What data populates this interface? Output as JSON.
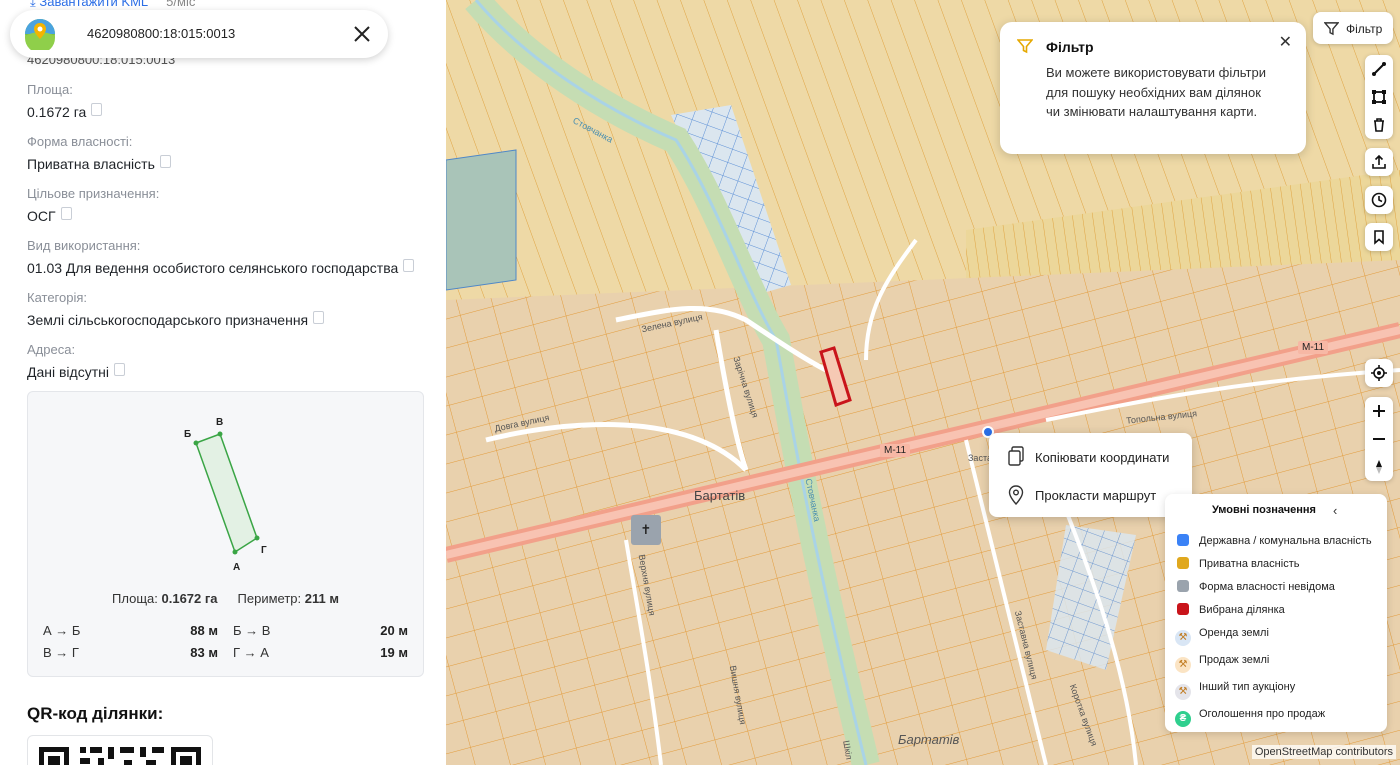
{
  "top_link": {
    "text": "Завантажити KML",
    "extra": "5/міс"
  },
  "search": {
    "cadastral": "4620980800:18:015:0013"
  },
  "parcel": {
    "id_partial": "4620980800:18:015:0013",
    "fields": [
      {
        "label": "Площа:",
        "value": "0.1672 га"
      },
      {
        "label": "Форма власності:",
        "value": "Приватна власність"
      },
      {
        "label": "Цільове призначення:",
        "value": "ОСГ"
      },
      {
        "label": "Вид використання:",
        "value": "01.03 Для ведення особистого селянського господарства"
      },
      {
        "label": "Категорія:",
        "value": "Землі сільськогосподарського призначення"
      },
      {
        "label": "Адреса:",
        "value": "Дані відсутні"
      }
    ]
  },
  "shape_card": {
    "vertices": [
      "А",
      "Б",
      "В",
      "Г"
    ],
    "area_label": "Площа:",
    "area_value": "0.1672 га",
    "perimeter_label": "Периметр:",
    "perimeter_value": "211 м",
    "segments": [
      {
        "label": "А → Б",
        "value": "88 м"
      },
      {
        "label": "Б → В",
        "value": "20 м"
      },
      {
        "label": "В → Г",
        "value": "83 м"
      },
      {
        "label": "Г → А",
        "value": "19 м"
      }
    ],
    "stroke_color": "#3aa545"
  },
  "qr": {
    "title": "QR-код ділянки:"
  },
  "filter_button": {
    "label": "Фільтр"
  },
  "filter_tip": {
    "title": "Фільтр",
    "body": "Ви можете використовувати фільтри для пошуку необхідних вам ділянок чи змінювати налаштування карти."
  },
  "context_menu": [
    {
      "label": "Копіювати координати",
      "icon": "copy-icon"
    },
    {
      "label": "Прокласти маршрут",
      "icon": "location-pin-icon"
    }
  ],
  "legend": {
    "title": "Умовні позначення",
    "items": [
      {
        "label": "Державна / комунальна власність",
        "color": "#3b82f6",
        "kind": "square"
      },
      {
        "label": "Приватна власність",
        "color": "#e0a81e",
        "kind": "square"
      },
      {
        "label": "Форма власності невідома",
        "color": "#9aa3ad",
        "kind": "square"
      },
      {
        "label": "Вибрана ділянка",
        "color": "#c9141b",
        "kind": "square"
      },
      {
        "label": "Оренда землі",
        "color": "#d9e6f5",
        "kind": "circle"
      },
      {
        "label": "Продаж землі",
        "color": "#fbe4c4",
        "kind": "circle"
      },
      {
        "label": "Інший тип аукціону",
        "color": "#e4e4ea",
        "kind": "circle"
      },
      {
        "label": "Оголошення про продаж",
        "color": "#2fcf8e",
        "kind": "circle",
        "glyph": "₴"
      }
    ]
  },
  "map_labels": {
    "village_1": "Бартатів",
    "village_2": "Бартатів",
    "road_1": "М-11",
    "road_2": "М-11",
    "stream_1": "Стовчанка",
    "stream_2": "Стовчанка",
    "street_green": "Зелена вулиця",
    "street_long": "Довга вулиця",
    "street_zarichna": "Зарічна вулиця",
    "street_topolna": "Топольна вулиця",
    "street_verkhnia": "Верхня вулиця",
    "street_zastavna": "Заставна вулиця",
    "street_korotka": "Коротка вулиця",
    "street_vyshnia": "Вишня вулиця",
    "street_partial_1": "Заста",
    "street_partial_2": "Шкіл"
  },
  "attribution": "OpenStreetMap contributors",
  "colors": {
    "accent": "#2b6ee6",
    "private_parcel": "#e8a93a",
    "selected": "#c9141b",
    "road": "#f2a08a"
  }
}
